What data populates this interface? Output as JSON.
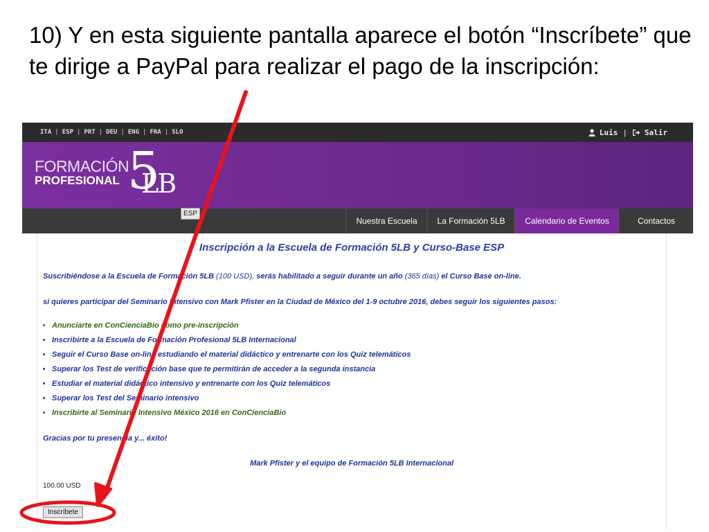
{
  "slide": {
    "title": "10) Y en esta siguiente pantalla aparece el botón “Inscríbete” que te dirige a PayPal para realizar el pago de la inscripción:"
  },
  "topbar": {
    "languages": [
      "ITA",
      "ESP",
      "PRT",
      "DEU",
      "ENG",
      "FRA",
      "SLO"
    ],
    "user_label": "Luis",
    "logout_label": "Salir"
  },
  "header": {
    "logo_line1": "FORMACIÓN",
    "logo_line2": "PROFESIONAL",
    "logo_five": "5",
    "logo_lb": "LB",
    "tooltip": "ESP"
  },
  "nav": {
    "items": [
      "Nuestra Escuela",
      "La Formación 5LB",
      "Calendario de Eventos",
      "Contactos"
    ],
    "active_index": 2
  },
  "content": {
    "title": "Inscripción a la Escuela de Formación 5LB y Curso-Base ESP",
    "intro_1": "Suscribiéndose a la Escuela de Formación 5LB",
    "intro_2": " (100 USD), ",
    "intro_3": "serás habilitado a seguir durante un año",
    "intro_4": " (365 días) ",
    "intro_5": "el Curso Base on-line.",
    "instructions": "si quieres participar del Seminario Intensivo con Mark Pfister en la Ciudad de México del 1-9 octubre 2016, debes seguir los siguientes pasos:",
    "steps": [
      "Anunciarte en ConCienciaBio como pre-inscripción",
      "Inscribirte a la Escuela de Formación Profesional 5LB Internacional",
      "Seguir el Curso Base on-line estudiando el material didáctico y entrenarte con los Quiz telemáticos",
      "Superar los Test de verificación base que te permitirán de acceder a la segunda instancia",
      "Estudiar el material didáctico intensivo y entrenarte con los Quiz telemáticos",
      "Superar los Test del Seminario intensivo",
      "Inscribirte al Seminario Intensivo México 2016 en ConCienciaBio"
    ],
    "thanks": "Gracias por tu presencia y... éxito!",
    "signature": "Mark Pfister y el equipo de Formación 5LB Internacional",
    "price": "100.00 USD",
    "button_label": "Inscríbete"
  },
  "colors": {
    "banner_purple": "#6d2c8e",
    "nav_active": "#7b2a9a",
    "title_blue": "#2a3fa6",
    "text_blue": "#1f3399",
    "text_green": "#2f6a12",
    "annotation_red": "#e8141b"
  },
  "icons": {
    "user": "user-icon",
    "logout": "logout-icon"
  }
}
